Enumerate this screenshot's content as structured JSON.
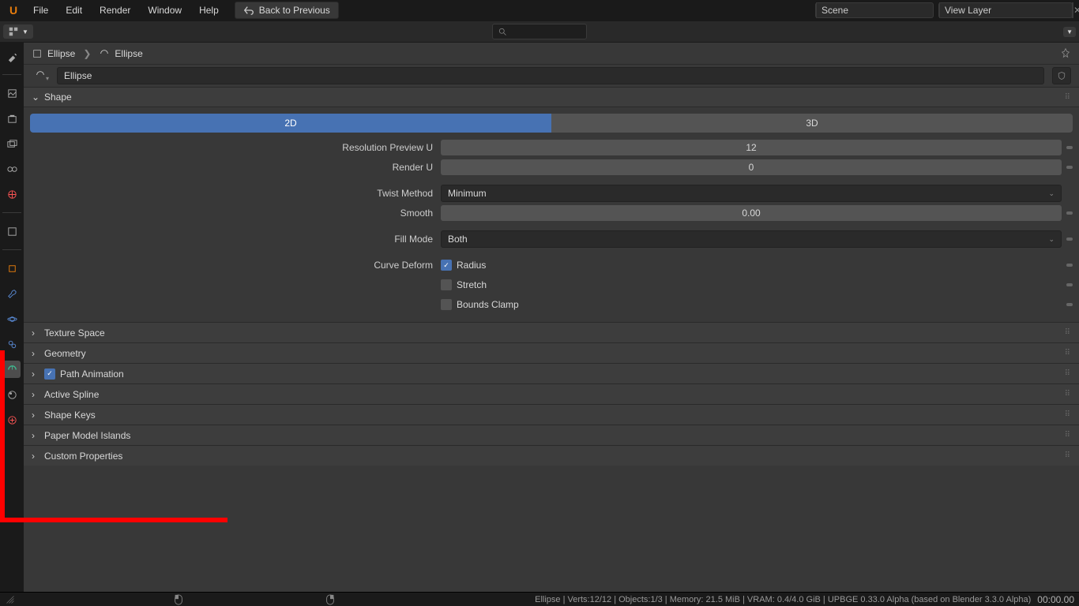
{
  "menu": {
    "items": [
      "File",
      "Edit",
      "Render",
      "Window",
      "Help"
    ],
    "back": "Back to Previous"
  },
  "top": {
    "scene": "Scene",
    "layer": "View Layer"
  },
  "bc": {
    "root": "Ellipse",
    "leaf": "Ellipse"
  },
  "name_field": "Ellipse",
  "shape": {
    "title": "Shape",
    "mode_2d": "2D",
    "mode_3d": "3D",
    "res_label": "Resolution Preview U",
    "res_val": "12",
    "render_label": "Render U",
    "render_val": "0",
    "twist_label": "Twist Method",
    "twist_val": "Minimum",
    "smooth_label": "Smooth",
    "smooth_val": "0.00",
    "fill_label": "Fill Mode",
    "fill_val": "Both",
    "deform_label": "Curve Deform",
    "radius": "Radius",
    "stretch": "Stretch",
    "bounds": "Bounds Clamp"
  },
  "panels": {
    "texture": "Texture Space",
    "geometry": "Geometry",
    "pathanim": "Path Animation",
    "spline": "Active Spline",
    "keys": "Shape Keys",
    "paper": "Paper Model Islands",
    "custom": "Custom Properties"
  },
  "status": "Ellipse | Verts:12/12 | Objects:1/3 | Memory: 21.5 MiB | VRAM: 0.4/4.0 GiB | UPBGE 0.33.0 Alpha (based on Blender 3.3.0 Alpha)",
  "status_time": "00:00.00"
}
